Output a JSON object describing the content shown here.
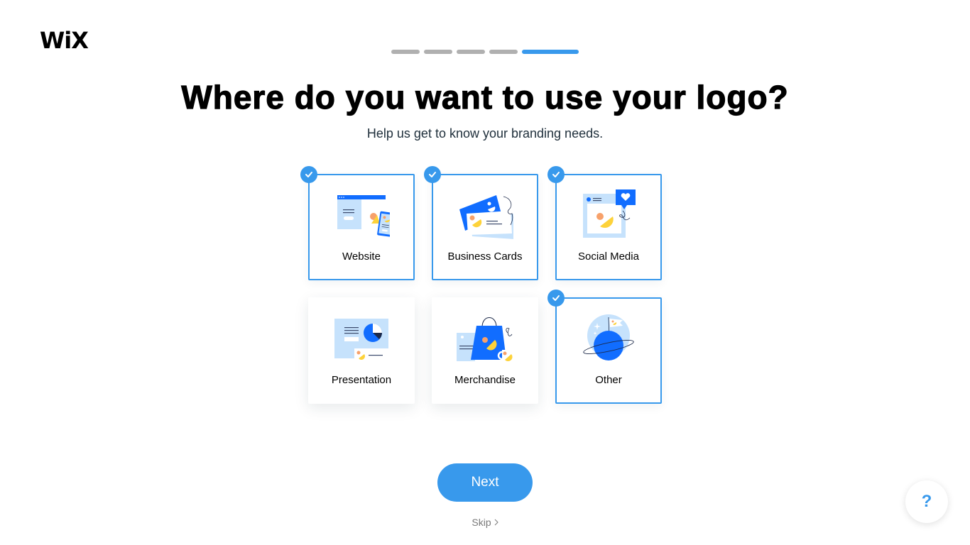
{
  "brand": {
    "logo_text": "WiX"
  },
  "progress": {
    "total_steps": 5,
    "current_step": 5
  },
  "header": {
    "title": "Where do you want to use your logo?",
    "subtitle": "Help us get to know your branding needs."
  },
  "options": [
    {
      "label": "Website",
      "icon": "website-illustration",
      "selected": true
    },
    {
      "label": "Business Cards",
      "icon": "business-cards-illustration",
      "selected": true
    },
    {
      "label": "Social Media",
      "icon": "social-media-illustration",
      "selected": true
    },
    {
      "label": "Presentation",
      "icon": "presentation-illustration",
      "selected": false
    },
    {
      "label": "Merchandise",
      "icon": "merchandise-illustration",
      "selected": false
    },
    {
      "label": "Other",
      "icon": "planet-illustration",
      "selected": true
    }
  ],
  "actions": {
    "next_label": "Next",
    "skip_label": "Skip",
    "skip_icon": "chevron-right-icon",
    "help_label": "?"
  },
  "colors": {
    "accent": "#3899ec",
    "illustration_blue": "#116dff",
    "illustration_light": "#c6e2fc",
    "illustration_orange": "#f7a16b",
    "illustration_yellow": "#fdd23a",
    "progress_inactive": "#b0b0b0"
  }
}
